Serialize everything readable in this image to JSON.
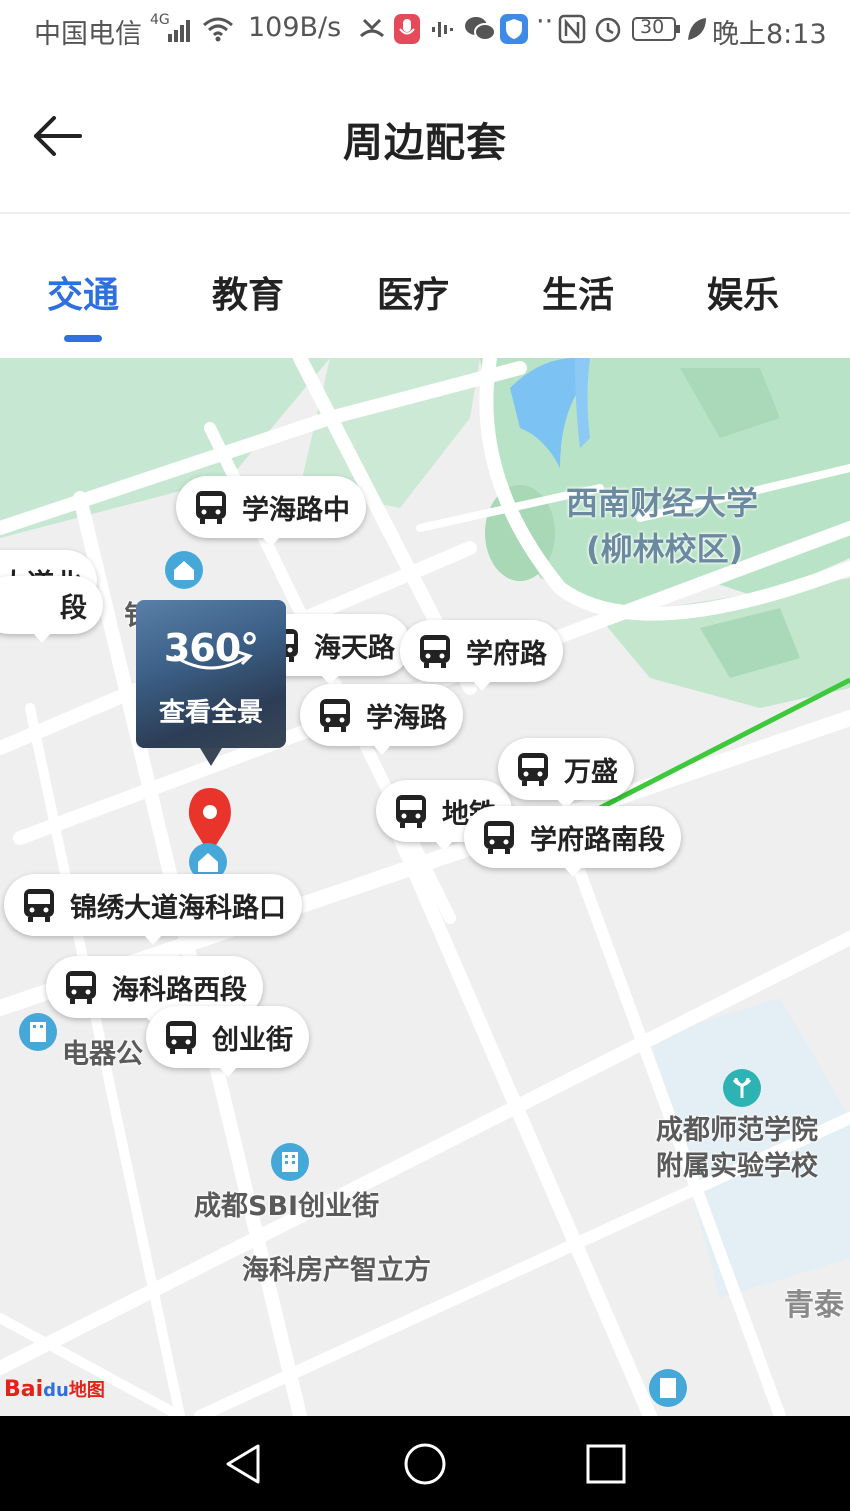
{
  "status_bar": {
    "carrier": "中国电信",
    "network": "4G",
    "speed": "109B/s",
    "battery": "30",
    "time": "晚上8:13",
    "icons": [
      "signal-icon",
      "wifi-icon",
      "missed-call-icon",
      "mic-icon",
      "audio-icon",
      "wechat-icon",
      "shield-icon",
      "nfc-icon",
      "alarm-icon",
      "battery-icon",
      "leaf-icon"
    ]
  },
  "header": {
    "title": "周边配套",
    "back_icon": "back-arrow-icon"
  },
  "tabs": {
    "items": [
      "交通",
      "教育",
      "医疗",
      "生活",
      "娱乐"
    ],
    "active_index": 0,
    "accent_color": "#2f6fe0"
  },
  "map": {
    "campus_label_1": "西南财经大学",
    "campus_label_2": "(柳林校区)",
    "school_label_1": "成都师范学院",
    "school_label_2": "附属实验学校",
    "poi_labels": [
      "成都SBI创业街",
      "海科房产智立方",
      "青泰",
      "电器公"
    ],
    "partial_labels": [
      "大道北",
      "段",
      "钅",
      "地铁"
    ],
    "pano": {
      "number": "360°",
      "label": "查看全景"
    },
    "bus_stops": [
      "学海路中",
      "海天路",
      "学府路",
      "学海路",
      "万盛",
      "学府路南段",
      "锦绣大道海科路口",
      "海科路西段",
      "创业街"
    ],
    "logo": {
      "part1": "Bai",
      "part2": "du",
      "part3": "地图"
    },
    "colors": {
      "water": "#7cc2f3",
      "green": "#b9e3c6",
      "road": "#ffffff",
      "metro_line": "#3dc93b",
      "marker": "#e8342a"
    }
  },
  "nav_bar": {
    "icons": [
      "back-triangle-icon",
      "home-circle-icon",
      "recents-square-icon"
    ]
  }
}
